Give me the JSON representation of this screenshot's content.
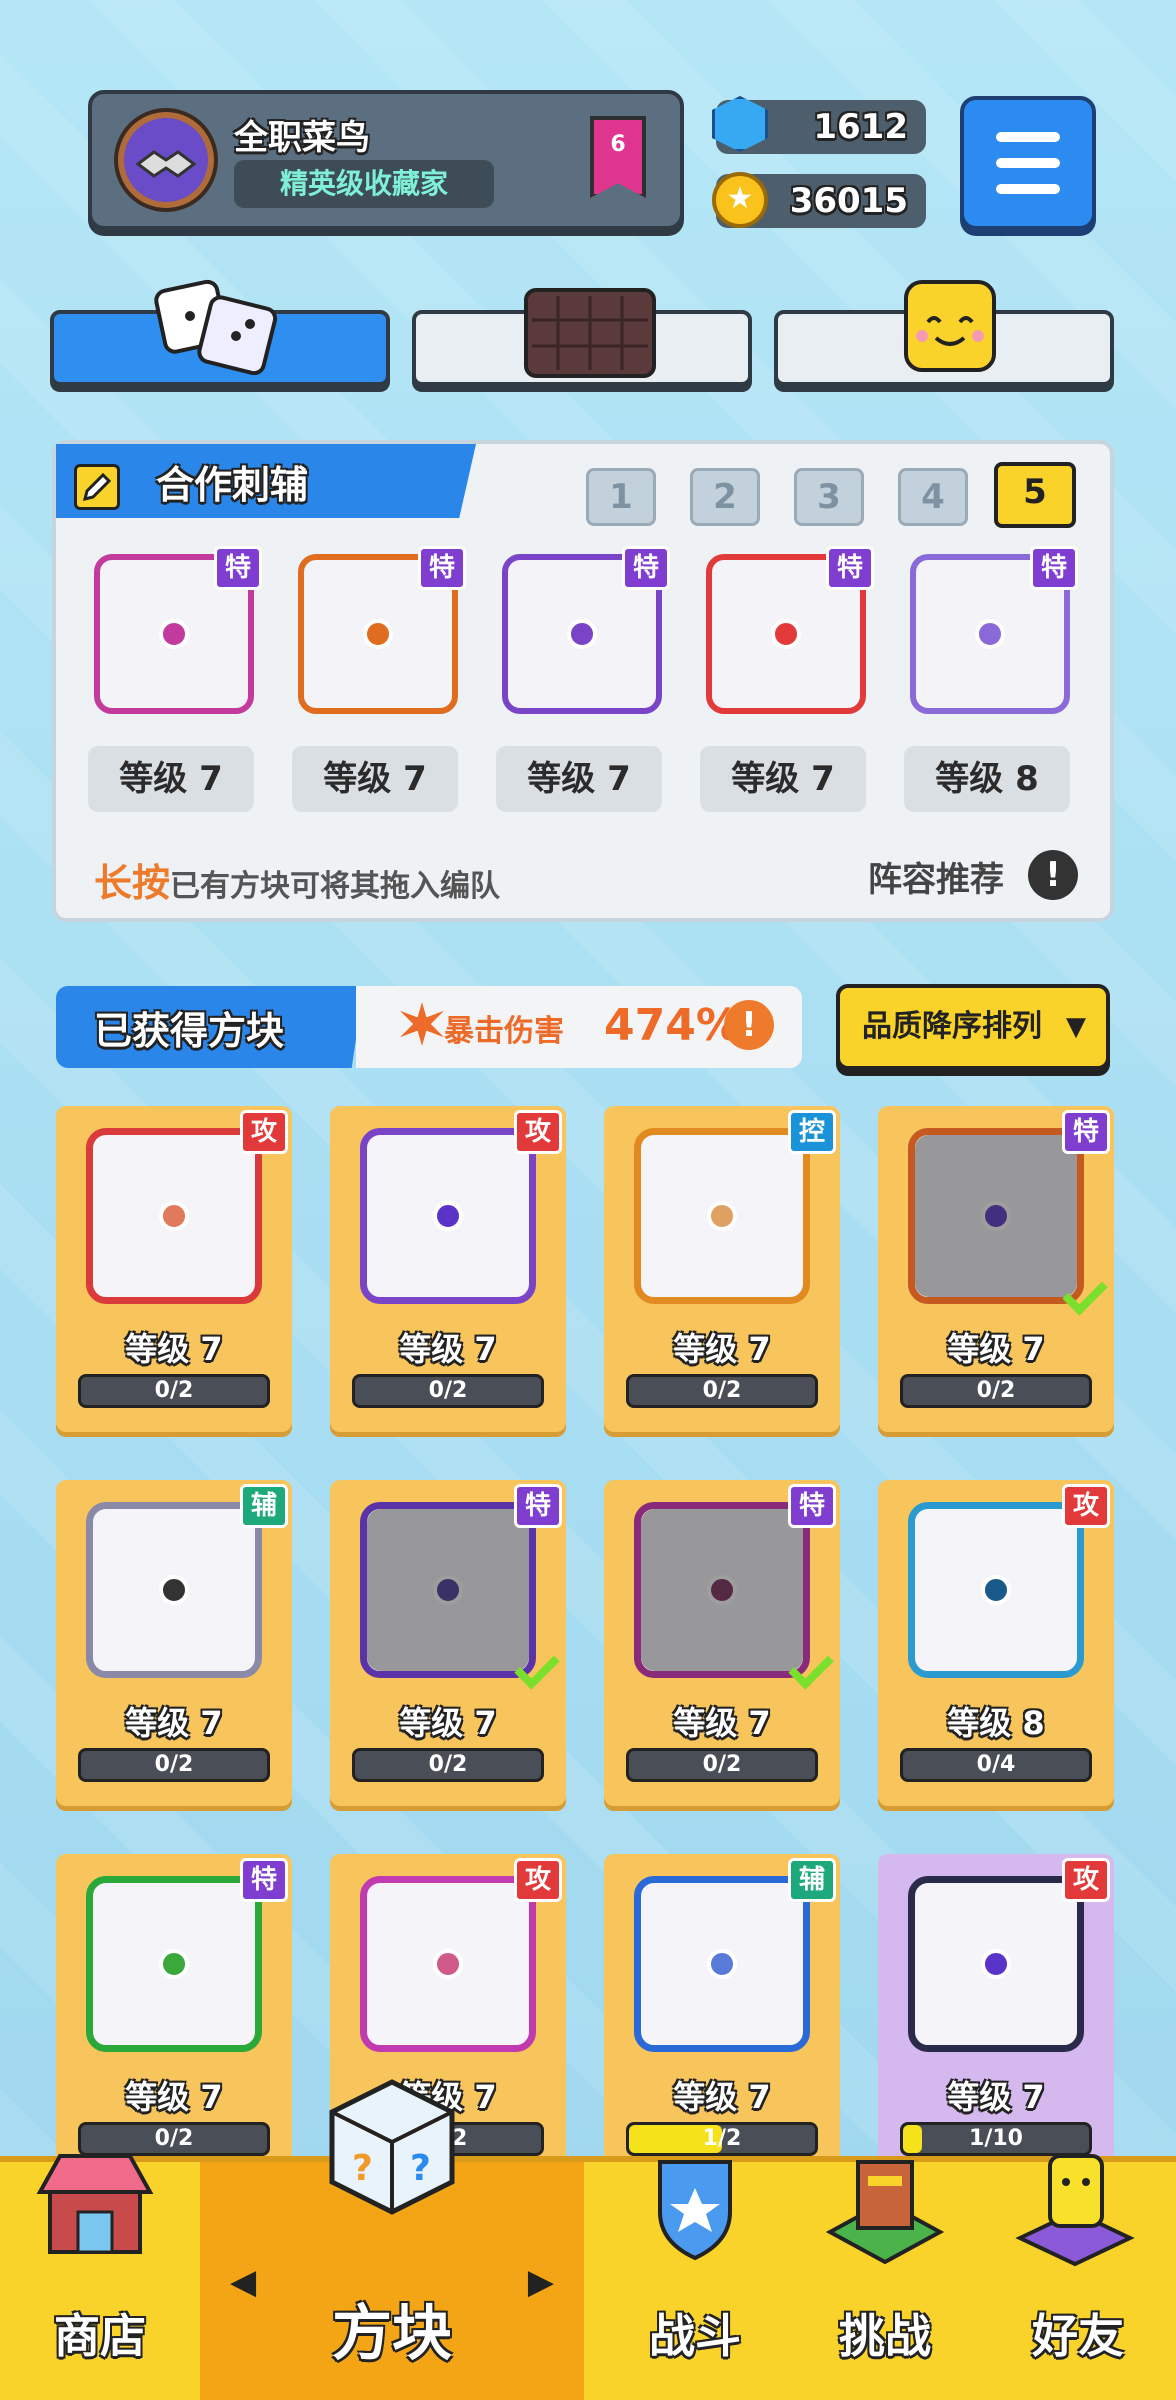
{
  "player": {
    "name": "全职菜鸟",
    "title": "精英级收藏家",
    "rank": "6"
  },
  "currency": {
    "gems": "1612",
    "coins": "36015"
  },
  "team": {
    "title": "合作刺辅",
    "slots": [
      "1",
      "2",
      "3",
      "4",
      "5"
    ],
    "selected_slot": "5",
    "cards": [
      {
        "tag": "特",
        "level": "等级 7",
        "color": "#c23a9c"
      },
      {
        "tag": "特",
        "level": "等级 7",
        "color": "#e06c1f"
      },
      {
        "tag": "特",
        "level": "等级 7",
        "color": "#7a44c8"
      },
      {
        "tag": "特",
        "level": "等级 7",
        "color": "#e23a3a"
      },
      {
        "tag": "特",
        "level": "等级 8",
        "color": "#8a6ad8"
      }
    ],
    "hint_highlight": "长按",
    "hint_text": "已有方块可将其拖入编队",
    "recommend": "阵容推荐",
    "recommend_icon": "!"
  },
  "obtained": {
    "title": "已获得方块",
    "crit_label": "暴击伤害",
    "crit_value": "474%",
    "crit_info": "!",
    "sort_label": "品质降序排列"
  },
  "grid": [
    {
      "tag": "攻",
      "tagtype": "gong",
      "level": "等级 7",
      "progress": "0/2",
      "fill": 0,
      "color": "#d93a3a",
      "dot": "#e07a5a",
      "equipped": false
    },
    {
      "tag": "攻",
      "tagtype": "gong",
      "level": "等级 7",
      "progress": "0/2",
      "fill": 0,
      "color": "#7a44c8",
      "dot": "#5a33c8",
      "equipped": false
    },
    {
      "tag": "控",
      "tagtype": "kong",
      "level": "等级 7",
      "progress": "0/2",
      "fill": 0,
      "color": "#e08a1f",
      "dot": "#e0a060",
      "equipped": false
    },
    {
      "tag": "特",
      "tagtype": "te",
      "level": "等级 7",
      "progress": "0/2",
      "fill": 0,
      "color": "#c45a1f",
      "dot": "#5a33c8",
      "equipped": true
    },
    {
      "tag": "辅",
      "tagtype": "fu",
      "level": "等级 7",
      "progress": "0/2",
      "fill": 0,
      "color": "#8a8aa8",
      "dot": "#333333",
      "equipped": false
    },
    {
      "tag": "特",
      "tagtype": "te",
      "level": "等级 7",
      "progress": "0/2",
      "fill": 0,
      "color": "#5a33a8",
      "dot": "#4a3a9a",
      "equipped": true
    },
    {
      "tag": "特",
      "tagtype": "te",
      "level": "等级 7",
      "progress": "0/2",
      "fill": 0,
      "color": "#8a2a7a",
      "dot": "#7a2a5a",
      "equipped": true
    },
    {
      "tag": "攻",
      "tagtype": "gong",
      "level": "等级 8",
      "progress": "0/4",
      "fill": 0,
      "color": "#2a9ad0",
      "dot": "#1a5a8a",
      "equipped": false
    },
    {
      "tag": "特",
      "tagtype": "te",
      "level": "等级 7",
      "progress": "0/2",
      "fill": 0,
      "color": "#2aa83a",
      "dot": "#3aa83a",
      "equipped": false
    },
    {
      "tag": "攻",
      "tagtype": "gong",
      "level": "等级 7",
      "progress": "0/2",
      "fill": 0,
      "color": "#c23ab0",
      "dot": "#d05a8a",
      "equipped": false
    },
    {
      "tag": "辅",
      "tagtype": "fu",
      "level": "等级 7",
      "progress": "1/2",
      "fill": 0.5,
      "color": "#2a6ad8",
      "dot": "#5a7ad8",
      "equipped": false
    },
    {
      "tag": "攻",
      "tagtype": "gong",
      "level": "等级 7",
      "progress": "1/10",
      "fill": 0.1,
      "color": "#2a2a4a",
      "dot": "#5a33c8",
      "equipped": false,
      "purple": true
    }
  ],
  "nav": {
    "shop": "商店",
    "blocks": "方块",
    "battle": "战斗",
    "challenge": "挑战",
    "friends": "好友"
  }
}
